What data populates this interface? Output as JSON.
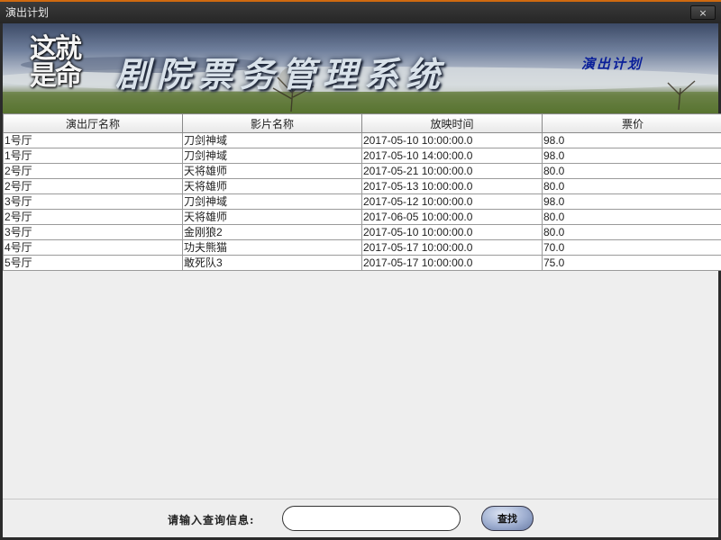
{
  "window": {
    "title": "演出计划",
    "close_label": "×"
  },
  "banner": {
    "logo_text": "这就是命",
    "title": "剧院票务管理系统",
    "subtitle": "演出计划"
  },
  "table": {
    "columns": [
      "演出厅名称",
      "影片名称",
      "放映时间",
      "票价"
    ],
    "rows": [
      [
        "1号厅",
        "刀剑神域",
        "2017-05-10 10:00:00.0",
        "98.0"
      ],
      [
        "1号厅",
        "刀剑神域",
        "2017-05-10 14:00:00.0",
        "98.0"
      ],
      [
        "2号厅",
        "天将雄师",
        "2017-05-21 10:00:00.0",
        "80.0"
      ],
      [
        "2号厅",
        "天将雄师",
        "2017-05-13 10:00:00.0",
        "80.0"
      ],
      [
        "3号厅",
        "刀剑神域",
        "2017-05-12 10:00:00.0",
        "98.0"
      ],
      [
        "2号厅",
        "天将雄师",
        "2017-06-05 10:00:00.0",
        "80.0"
      ],
      [
        "3号厅",
        "金刚狼2",
        "2017-05-10 10:00:00.0",
        "80.0"
      ],
      [
        "4号厅",
        "功夫熊猫",
        "2017-05-17 10:00:00.0",
        "70.0"
      ],
      [
        "5号厅",
        "敢死队3",
        "2017-05-17 10:00:00.0",
        "75.0"
      ]
    ]
  },
  "search": {
    "label": "请输入查询信息:",
    "value": "",
    "placeholder": "",
    "button_label": "查找"
  }
}
